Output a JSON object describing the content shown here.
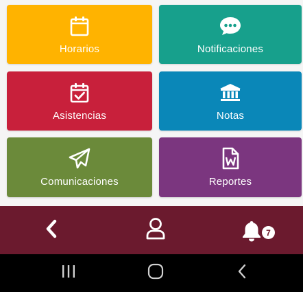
{
  "colors": {
    "horarios": "#ffb300",
    "notificaciones": "#17a08c",
    "asistencias": "#c8203b",
    "notas": "#0a87b8",
    "comunicaciones": "#6b8a3a",
    "reportes": "#7b367f",
    "bottom_bar": "#6b1a2e",
    "system_bar": "#000000"
  },
  "tiles": [
    {
      "label": "Horarios",
      "icon": "calendar-icon"
    },
    {
      "label": "Notificaciones",
      "icon": "chat-bubble-icon"
    },
    {
      "label": "Asistencias",
      "icon": "calendar-check-icon"
    },
    {
      "label": "Notas",
      "icon": "institution-icon"
    },
    {
      "label": "Comunicaciones",
      "icon": "paper-plane-icon"
    },
    {
      "label": "Reportes",
      "icon": "word-file-icon"
    }
  ],
  "bottom_bar": {
    "back_icon": "chevron-left-icon",
    "profile_icon": "user-icon",
    "notifications_icon": "bell-icon",
    "notification_count": "7"
  },
  "system_bar": {
    "recent_icon": "recent-apps-icon",
    "home_icon": "home-icon",
    "back_icon": "back-icon"
  }
}
